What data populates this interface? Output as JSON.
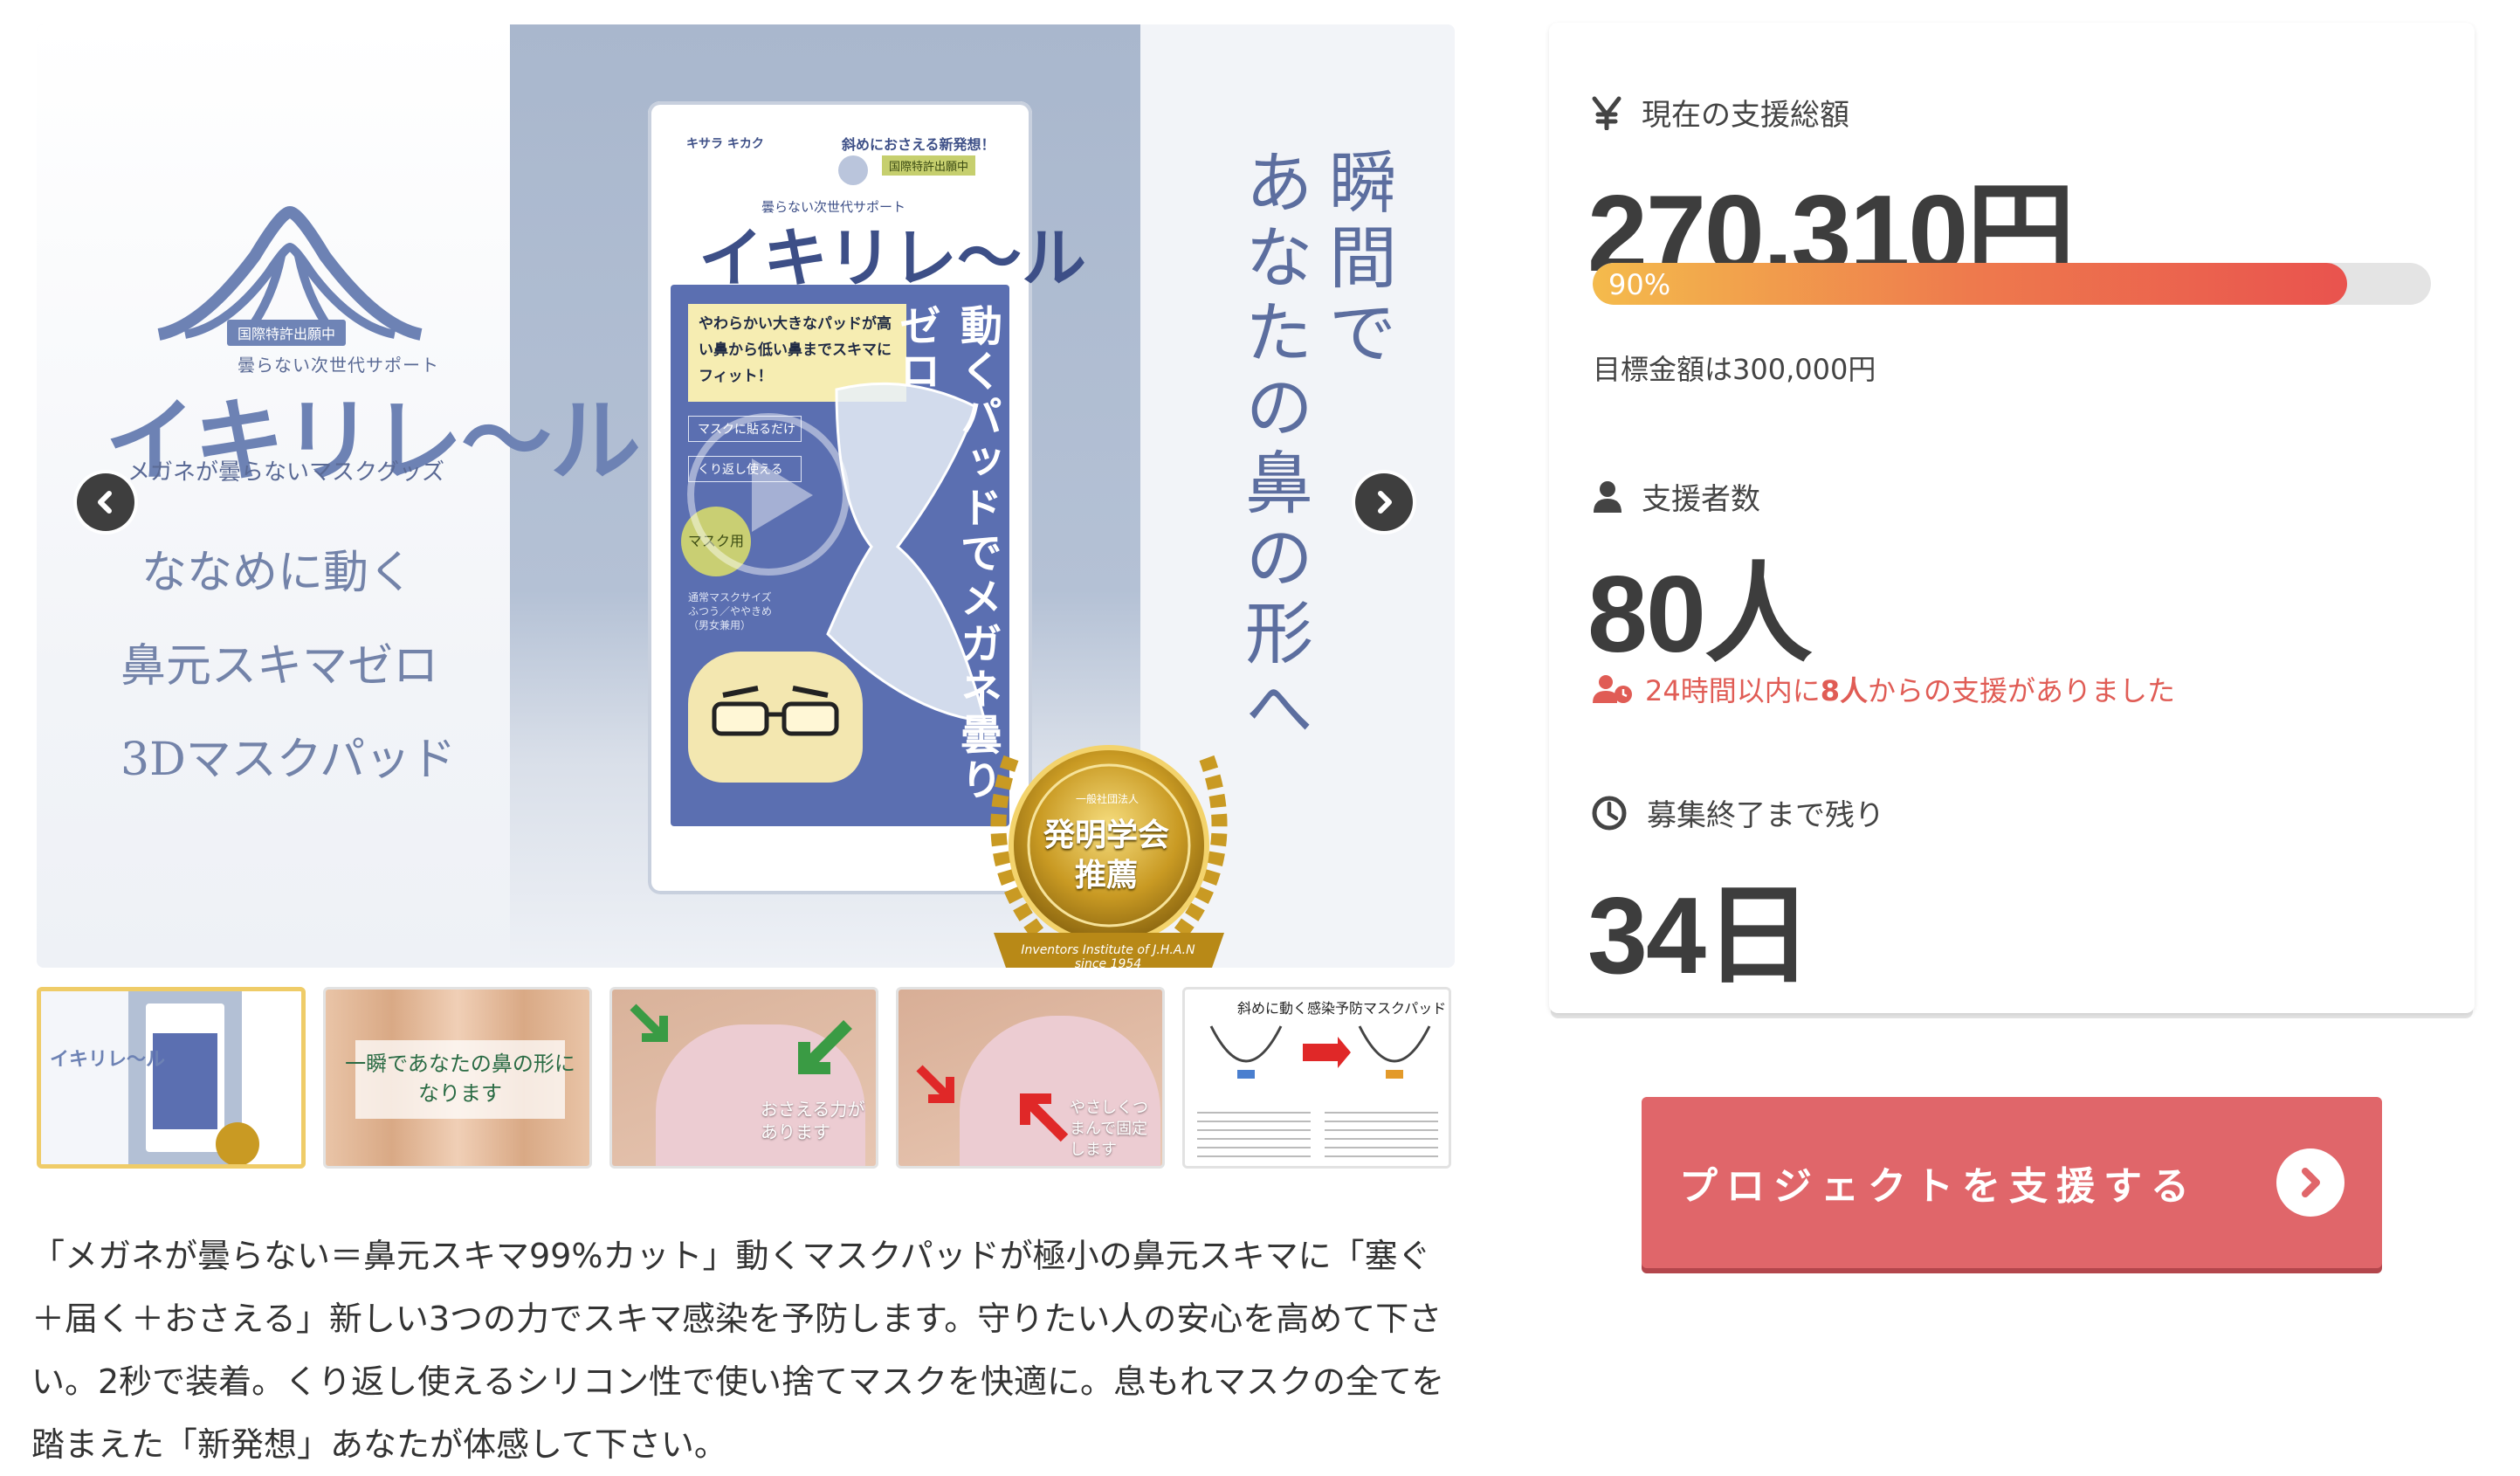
{
  "gallery": {
    "brand": {
      "patent_tag": "国際特許出願中",
      "subtitle": "曇らない次世代サポート",
      "name": "イキリレ〜ル",
      "tagline": "メガネが曇らないマスクグッズ"
    },
    "copy_lines": [
      "ななめに動く",
      "鼻元スキマゼロ",
      "3Dマスクパッド"
    ],
    "package": {
      "maker": "キサラ  キカク",
      "lead": "斜めにおさえる新発想！",
      "patent": "国際特許出願中",
      "subtitle": "曇らない次世代サポート",
      "name": "イキリレ〜ル",
      "yellow_box": "やわらかい大きなパッドが高い鼻から低い鼻までスキマにフィット！",
      "chips": [
        "マスクに貼るだけ",
        "くり返し使える"
      ],
      "mask_tag": "マスク用",
      "specs": "通常マスクサイズ ふつう／ややきめ （男女兼用）",
      "vertical": "動くパッドでメガネ曇りゼロ"
    },
    "medal": {
      "top": "一般社団法人",
      "text": [
        "発明学会",
        "推薦"
      ],
      "ribbon": "Inventors Institute of J.H.A.N since 1954"
    },
    "headline": [
      "瞬間で",
      "あなたの鼻の形へ"
    ],
    "thumbnails": [
      {
        "label": "イキリレ〜ル",
        "active": true
      },
      {
        "label": "一瞬であなたの鼻の形になります",
        "active": false
      },
      {
        "label": "おさえる力があります",
        "active": false
      },
      {
        "label": "やさしくつまんで固定します",
        "active": false
      },
      {
        "label": "斜めに動く感染予防マスクパッド",
        "active": false
      }
    ]
  },
  "description": "「メガネが曇らない＝鼻元スキマ99%カット」動くマスクパッドが極小の鼻元スキマに「塞ぐ＋届く＋おさえる」新しい3つの力でスキマ感染を予防します。守りたい人の安心を高めて下さい。2秒で装着。くり返し使えるシリコン性で使い捨てマスクを快適に。息もれマスクの全てを踏まえた「新発想」あなたが体感して下さい。",
  "stats": {
    "total": {
      "icon": "yen-icon",
      "label": "現在の支援総額",
      "value": "270,310円",
      "progress_percent": 90,
      "progress_label": "90%",
      "goal_text": "目標金額は300,000円"
    },
    "backers": {
      "icon": "user-icon",
      "label": "支援者数",
      "value": "80人",
      "recent_prefix": "24時間以内に",
      "recent_count": "8人",
      "recent_suffix": "からの支援がありました"
    },
    "remaining": {
      "icon": "clock-icon",
      "label": "募集終了まで残り",
      "value": "34日"
    }
  },
  "cta": {
    "label": "プロジェクトを支援する",
    "icon": "chevron-right-circle-icon"
  },
  "colors": {
    "accent": "#e0666a",
    "progress_start": "#f4bb4c",
    "progress_end": "#e9534e",
    "recent_note": "#e05c55",
    "brand_blue": "#6d82b4"
  }
}
